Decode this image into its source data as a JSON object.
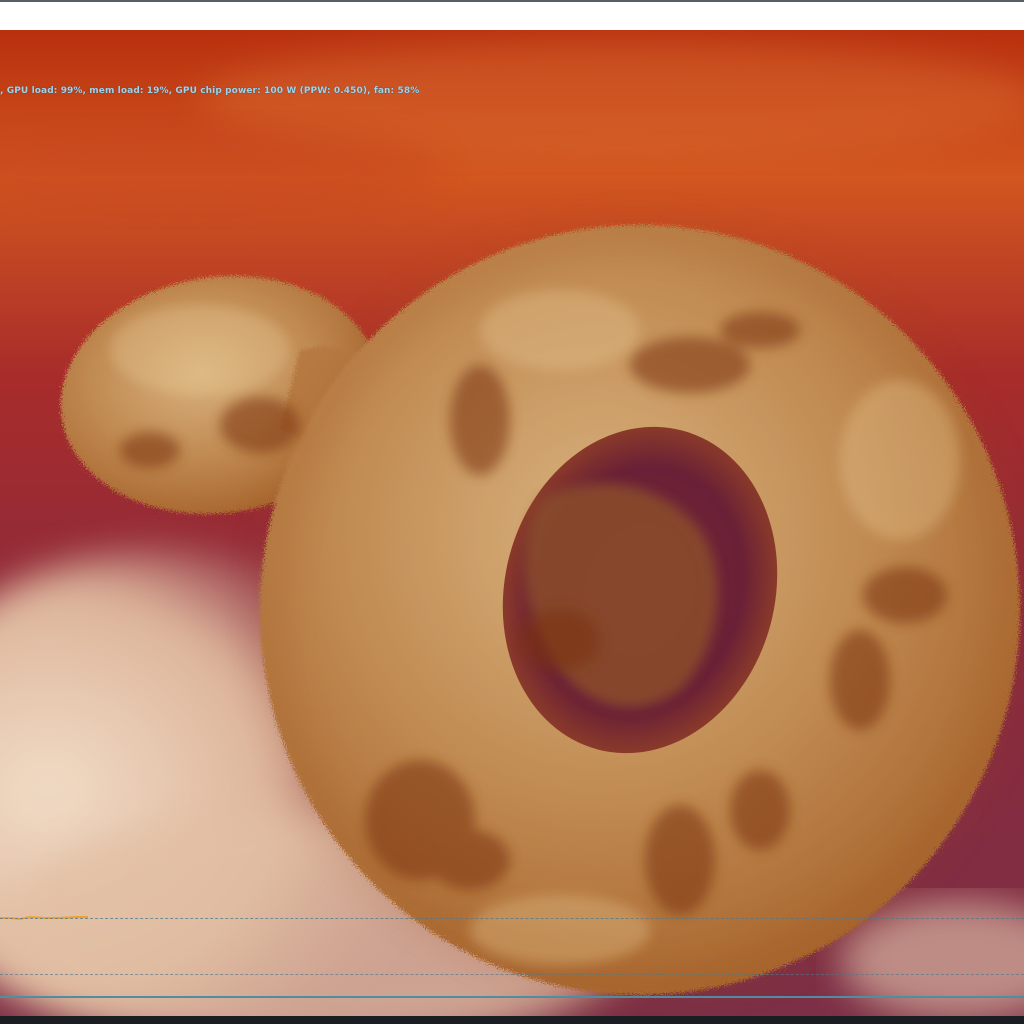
{
  "osd": {
    "stats_text": ", GPU load: 99%, mem load: 19%, GPU chip power: 100 W (PPW: 0.450), fan: 58%",
    "text_color": "#9fd3e8"
  },
  "scene": {
    "palette": {
      "sky_top": "#c8401a",
      "sky_mid": "#9a2a33",
      "sky_bottom": "#7a2a44",
      "fur_light": "#c79a66",
      "fur_dark": "#8a3d12",
      "cloud": "#e8cbb0"
    }
  },
  "graph": {
    "line_color": "#4f8ea0",
    "trace_color": "#f0a030"
  }
}
